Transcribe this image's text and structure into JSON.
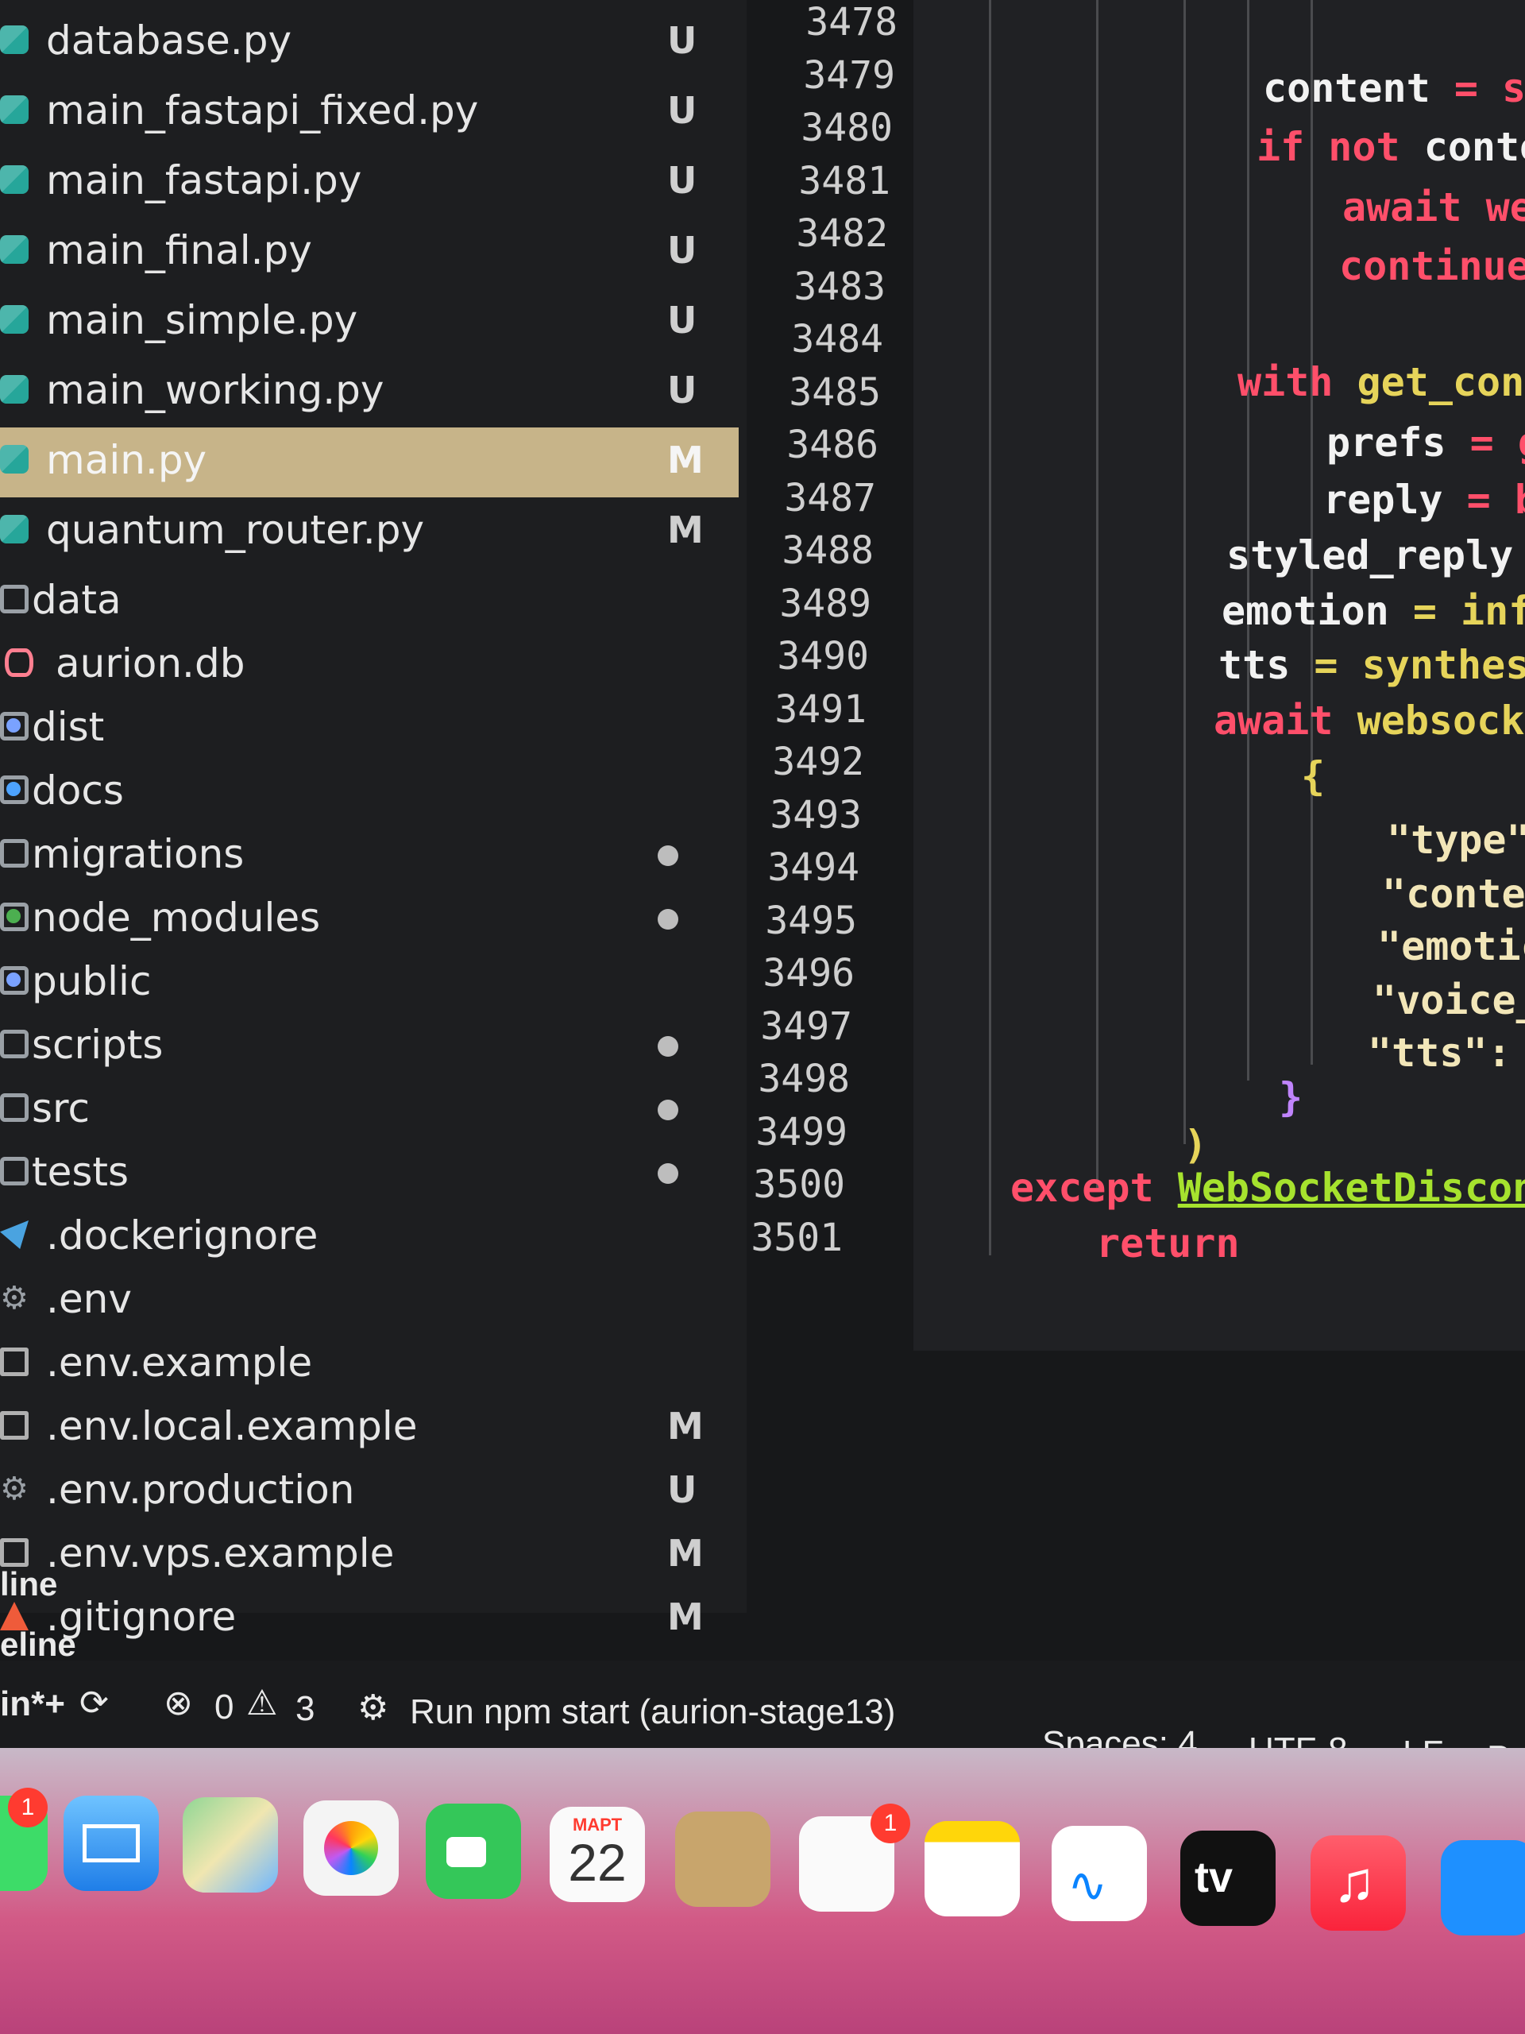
{
  "explorer": {
    "items": [
      {
        "name": "database.py",
        "badge": "U",
        "icon": "python-file-icon",
        "kind": "py"
      },
      {
        "name": "main_fastapi_fixed.py",
        "badge": "U",
        "icon": "python-file-icon",
        "kind": "py"
      },
      {
        "name": "main_fastapi.py",
        "badge": "U",
        "icon": "python-file-icon",
        "kind": "py"
      },
      {
        "name": "main_final.py",
        "badge": "U",
        "icon": "python-file-icon",
        "kind": "py"
      },
      {
        "name": "main_simple.py",
        "badge": "U",
        "icon": "python-file-icon",
        "kind": "py"
      },
      {
        "name": "main_working.py",
        "badge": "U",
        "icon": "python-file-icon",
        "kind": "py"
      },
      {
        "name": "main.py",
        "badge": "M",
        "icon": "python-file-icon",
        "kind": "py",
        "selected": true
      },
      {
        "name": "quantum_router.py",
        "badge": "M",
        "icon": "python-file-icon",
        "kind": "py"
      },
      {
        "name": "data",
        "badge": "",
        "icon": "folder-icon",
        "kind": "folder"
      },
      {
        "name": "aurion.db",
        "badge": "",
        "icon": "database-icon",
        "kind": "db"
      },
      {
        "name": "dist",
        "badge": "",
        "icon": "folder-icon",
        "kind": "folder"
      },
      {
        "name": "docs",
        "badge": "",
        "icon": "folder-icon",
        "kind": "folder"
      },
      {
        "name": "migrations",
        "badge": "dot",
        "icon": "folder-icon",
        "kind": "folder"
      },
      {
        "name": "node_modules",
        "badge": "dot",
        "icon": "folder-icon",
        "kind": "folder"
      },
      {
        "name": "public",
        "badge": "",
        "icon": "folder-icon",
        "kind": "folder"
      },
      {
        "name": "scripts",
        "badge": "dot",
        "icon": "folder-icon",
        "kind": "folder"
      },
      {
        "name": "src",
        "badge": "dot",
        "icon": "folder-icon",
        "kind": "folder"
      },
      {
        "name": "tests",
        "badge": "dot",
        "icon": "folder-icon",
        "kind": "folder"
      },
      {
        "name": ".dockerignore",
        "badge": "",
        "icon": "docker-icon",
        "kind": "docker"
      },
      {
        "name": ".env",
        "badge": "",
        "icon": "gear-icon",
        "kind": "gear"
      },
      {
        "name": ".env.example",
        "badge": "",
        "icon": "file-icon",
        "kind": "file"
      },
      {
        "name": ".env.local.example",
        "badge": "M",
        "icon": "file-icon",
        "kind": "file"
      },
      {
        "name": ".env.production",
        "badge": "U",
        "icon": "gear-icon",
        "kind": "gear"
      },
      {
        "name": ".env.vps.example",
        "badge": "M",
        "icon": "file-icon",
        "kind": "file"
      },
      {
        "name": ".gitignore",
        "badge": "M",
        "icon": "git-icon",
        "kind": "git"
      }
    ]
  },
  "gutter": {
    "lines": [
      "3478",
      "3479",
      "3480",
      "3481",
      "3482",
      "3483",
      "3484",
      "3485",
      "3486",
      "3487",
      "3488",
      "3489",
      "3490",
      "3491",
      "3492",
      "3493",
      "3494",
      "3495",
      "3496",
      "3497",
      "3498",
      "3499",
      "3500",
      "3501"
    ]
  },
  "code": {
    "l1_a": "content ",
    "l1_b": "= s",
    "l2_kw": "if not ",
    "l2_b": "conte",
    "l3": "await we",
    "l4": "continue",
    "l5_kw": "with ",
    "l5_fn": "get_conn",
    "l6_a": "prefs ",
    "l6_b": "= g",
    "l7_a": "reply ",
    "l7_b": "= b",
    "l8": "styled_reply",
    "l9_a": "emotion ",
    "l9_b": "= infe",
    "l10_a": "tts ",
    "l10_b": "= synthesi",
    "l11_kw": "await ",
    "l11_fn": "websocke",
    "l12": "{",
    "l13": "\"type\"",
    "l14": "\"conten",
    "l15": "\"emotic",
    "l16": "\"voice_",
    "l17": "\"tts\":",
    "l18": "}",
    "l19": ")",
    "l20_kw": "except ",
    "l20_ex": "WebSocketDisconne",
    "l21": "return"
  },
  "panel": {
    "row1": "line",
    "row2": "eline"
  },
  "status": {
    "branch": "in*+",
    "errors": "0",
    "warnings": "3",
    "task": "Run npm start (aurion-stage13)",
    "spaces": "Spaces: 4",
    "encoding": "UTF-8",
    "eol": "LF",
    "lang": "Py"
  },
  "dock": {
    "calendar_month": "МАРТ",
    "calendar_day": "22",
    "tv_label": "tv",
    "messages_badge": "1",
    "reminders_badge": "1"
  },
  "colors": {
    "selection": "#c7b489",
    "keyword": "#ff4f6a",
    "function": "#e6d45a"
  }
}
